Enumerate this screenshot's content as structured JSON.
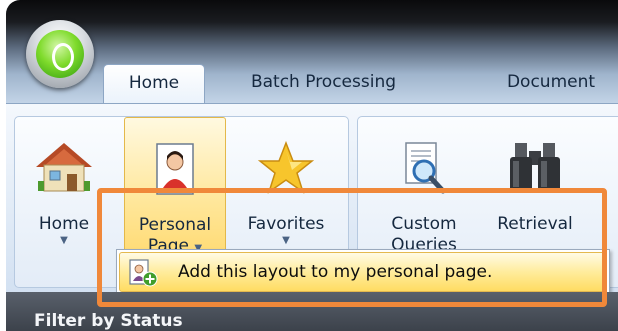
{
  "ribbon": {
    "app_orb": "app-orb-icon",
    "tabs": [
      {
        "label": "Home",
        "active": true
      },
      {
        "label": "Batch Processing",
        "active": false
      },
      {
        "label": "Document",
        "active": false
      }
    ],
    "buttons": {
      "home": {
        "label": "Home",
        "icon": "house-icon"
      },
      "personal_page": {
        "label_line1": "Personal",
        "label_line2": "Page",
        "icon": "personal-page-icon"
      },
      "favorites": {
        "label": "Favorites",
        "icon": "star-icon"
      },
      "custom_queries": {
        "label_line1": "Custom",
        "label_line2": "Queries",
        "icon": "magnifier-document-icon"
      },
      "retrieval": {
        "label": "Retrieval",
        "icon": "binoculars-icon"
      }
    }
  },
  "dropdown": {
    "items": [
      {
        "label": "Add this layout to my personal page.",
        "icon": "add-to-personal-page-icon"
      }
    ]
  },
  "status_bar": {
    "text": "Filter by Status"
  },
  "colors": {
    "highlight": "#f0883a",
    "hover": "#ffe08a",
    "accent": "#15283f"
  }
}
